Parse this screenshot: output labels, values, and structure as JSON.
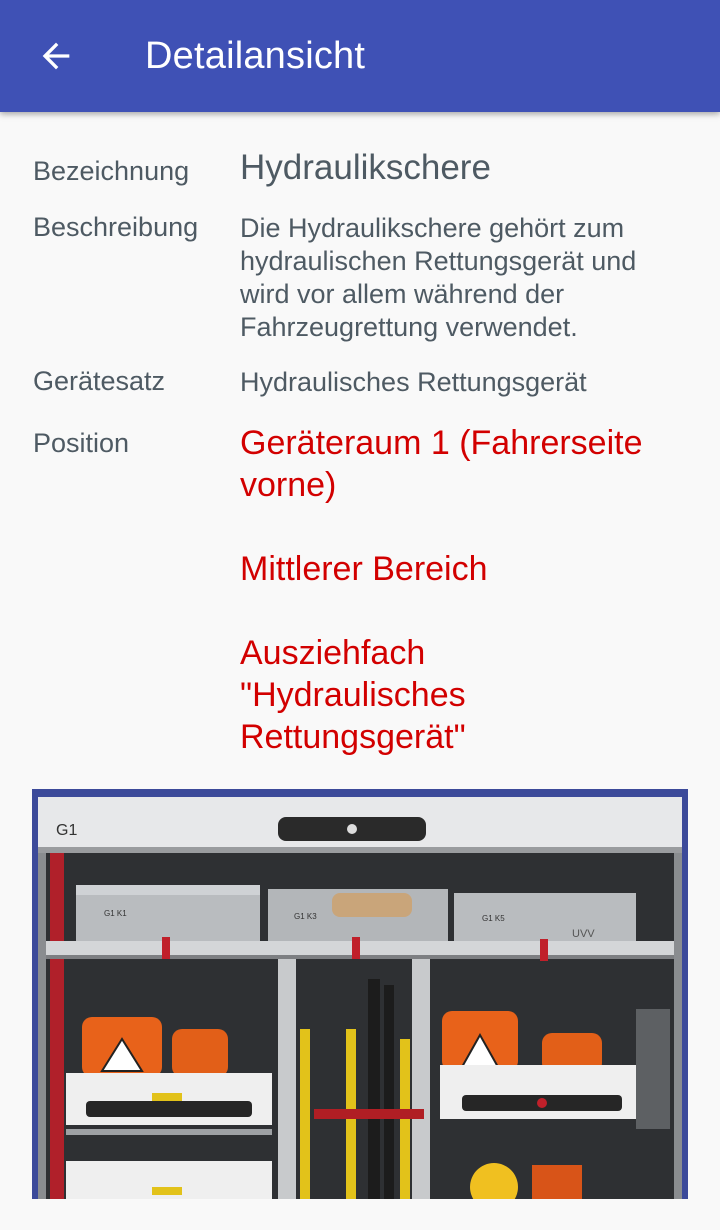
{
  "appbar": {
    "title": "Detailansicht",
    "back_icon": "arrow-left-icon",
    "color": "#3f51b5"
  },
  "details": {
    "bezeichnung": {
      "label": "Bezeichnung",
      "value": "Hydraulikschere"
    },
    "beschreibung": {
      "label": "Beschreibung",
      "lines": [
        "Die Hydraulikschere gehört zum",
        "hydraulischen Rettungsgerät und",
        "wird vor allem während der",
        "Fahrzeugrettung verwendet."
      ]
    },
    "geraetesatz": {
      "label": "Gerätesatz",
      "value": "Hydraulisches Rettungsgerät"
    },
    "position": {
      "label": "Position",
      "color": "#d20000",
      "lines": [
        "Geräteraum 1 (Fahrerseite",
        "vorne)",
        "",
        "Mittlerer Bereich",
        "",
        "Ausziehfach",
        "\"Hydraulisches",
        "Rettungsgerät\""
      ]
    }
  },
  "photo": {
    "compartment_label": "G1",
    "box_labels": [
      "G1 K1",
      "G1 K3",
      "G1 K5"
    ],
    "tape_label": "UVV"
  }
}
